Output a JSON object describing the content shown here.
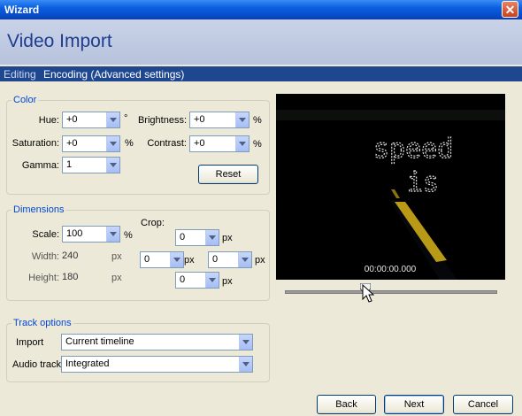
{
  "window": {
    "title": "Wizard",
    "close_icon": "close-icon"
  },
  "header": {
    "title": "Video Import"
  },
  "breadcrumb": {
    "step1": "Editing",
    "step2": "Encoding (Advanced settings)"
  },
  "color": {
    "legend": "Color",
    "hue_label": "Hue:",
    "hue_value": "+0",
    "hue_unit": "°",
    "saturation_label": "Saturation:",
    "saturation_value": "+0",
    "saturation_unit": "%",
    "gamma_label": "Gamma:",
    "gamma_value": "1",
    "brightness_label": "Brightness:",
    "brightness_value": "+0",
    "brightness_unit": "%",
    "contrast_label": "Contrast:",
    "contrast_value": "+0",
    "contrast_unit": "%",
    "reset_label": "Reset"
  },
  "dimensions": {
    "legend": "Dimensions",
    "scale_label": "Scale:",
    "scale_value": "100",
    "scale_unit": "%",
    "width_label": "Width:",
    "width_value": "240",
    "width_unit": "px",
    "height_label": "Height:",
    "height_value": "180",
    "height_unit": "px",
    "crop_label": "Crop:",
    "crop_top": "0",
    "crop_left": "0",
    "crop_right": "0",
    "crop_bottom": "0",
    "px": "px"
  },
  "track": {
    "legend": "Track options",
    "import_label": "Import",
    "import_value": "Current timeline",
    "audio_label": "Audio track:",
    "audio_value": "Integrated"
  },
  "preview": {
    "text_line1": "speed",
    "text_line2": "is",
    "timecode": "00:00:00.000",
    "position_fraction": 0.38
  },
  "buttons": {
    "back": "Back",
    "next": "Next",
    "cancel": "Cancel"
  },
  "colors": {
    "titlebar": "#0a5fe0",
    "accent": "#1e4790",
    "legend": "#0046d5"
  }
}
